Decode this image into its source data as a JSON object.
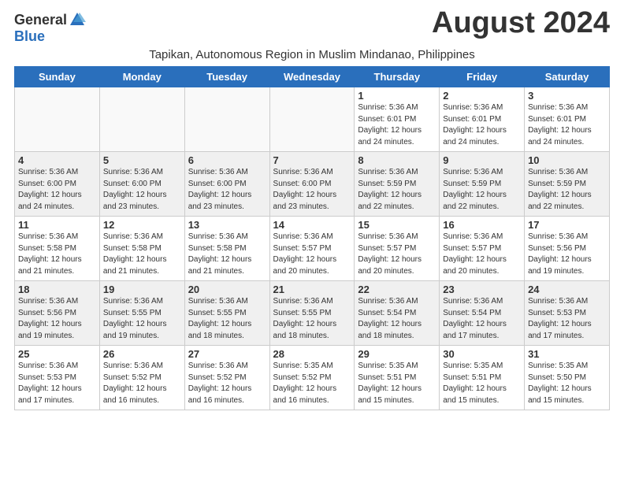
{
  "header": {
    "logo_general": "General",
    "logo_blue": "Blue",
    "month_title": "August 2024",
    "subtitle": "Tapikan, Autonomous Region in Muslim Mindanao, Philippines"
  },
  "days_of_week": [
    "Sunday",
    "Monday",
    "Tuesday",
    "Wednesday",
    "Thursday",
    "Friday",
    "Saturday"
  ],
  "weeks": [
    {
      "shade": "white",
      "cells": [
        {
          "day": "",
          "info": ""
        },
        {
          "day": "",
          "info": ""
        },
        {
          "day": "",
          "info": ""
        },
        {
          "day": "",
          "info": ""
        },
        {
          "day": "1",
          "info": "Sunrise: 5:36 AM\nSunset: 6:01 PM\nDaylight: 12 hours\nand 24 minutes."
        },
        {
          "day": "2",
          "info": "Sunrise: 5:36 AM\nSunset: 6:01 PM\nDaylight: 12 hours\nand 24 minutes."
        },
        {
          "day": "3",
          "info": "Sunrise: 5:36 AM\nSunset: 6:01 PM\nDaylight: 12 hours\nand 24 minutes."
        }
      ]
    },
    {
      "shade": "shaded",
      "cells": [
        {
          "day": "4",
          "info": "Sunrise: 5:36 AM\nSunset: 6:00 PM\nDaylight: 12 hours\nand 24 minutes."
        },
        {
          "day": "5",
          "info": "Sunrise: 5:36 AM\nSunset: 6:00 PM\nDaylight: 12 hours\nand 23 minutes."
        },
        {
          "day": "6",
          "info": "Sunrise: 5:36 AM\nSunset: 6:00 PM\nDaylight: 12 hours\nand 23 minutes."
        },
        {
          "day": "7",
          "info": "Sunrise: 5:36 AM\nSunset: 6:00 PM\nDaylight: 12 hours\nand 23 minutes."
        },
        {
          "day": "8",
          "info": "Sunrise: 5:36 AM\nSunset: 5:59 PM\nDaylight: 12 hours\nand 22 minutes."
        },
        {
          "day": "9",
          "info": "Sunrise: 5:36 AM\nSunset: 5:59 PM\nDaylight: 12 hours\nand 22 minutes."
        },
        {
          "day": "10",
          "info": "Sunrise: 5:36 AM\nSunset: 5:59 PM\nDaylight: 12 hours\nand 22 minutes."
        }
      ]
    },
    {
      "shade": "white",
      "cells": [
        {
          "day": "11",
          "info": "Sunrise: 5:36 AM\nSunset: 5:58 PM\nDaylight: 12 hours\nand 21 minutes."
        },
        {
          "day": "12",
          "info": "Sunrise: 5:36 AM\nSunset: 5:58 PM\nDaylight: 12 hours\nand 21 minutes."
        },
        {
          "day": "13",
          "info": "Sunrise: 5:36 AM\nSunset: 5:58 PM\nDaylight: 12 hours\nand 21 minutes."
        },
        {
          "day": "14",
          "info": "Sunrise: 5:36 AM\nSunset: 5:57 PM\nDaylight: 12 hours\nand 20 minutes."
        },
        {
          "day": "15",
          "info": "Sunrise: 5:36 AM\nSunset: 5:57 PM\nDaylight: 12 hours\nand 20 minutes."
        },
        {
          "day": "16",
          "info": "Sunrise: 5:36 AM\nSunset: 5:57 PM\nDaylight: 12 hours\nand 20 minutes."
        },
        {
          "day": "17",
          "info": "Sunrise: 5:36 AM\nSunset: 5:56 PM\nDaylight: 12 hours\nand 19 minutes."
        }
      ]
    },
    {
      "shade": "shaded",
      "cells": [
        {
          "day": "18",
          "info": "Sunrise: 5:36 AM\nSunset: 5:56 PM\nDaylight: 12 hours\nand 19 minutes."
        },
        {
          "day": "19",
          "info": "Sunrise: 5:36 AM\nSunset: 5:55 PM\nDaylight: 12 hours\nand 19 minutes."
        },
        {
          "day": "20",
          "info": "Sunrise: 5:36 AM\nSunset: 5:55 PM\nDaylight: 12 hours\nand 18 minutes."
        },
        {
          "day": "21",
          "info": "Sunrise: 5:36 AM\nSunset: 5:55 PM\nDaylight: 12 hours\nand 18 minutes."
        },
        {
          "day": "22",
          "info": "Sunrise: 5:36 AM\nSunset: 5:54 PM\nDaylight: 12 hours\nand 18 minutes."
        },
        {
          "day": "23",
          "info": "Sunrise: 5:36 AM\nSunset: 5:54 PM\nDaylight: 12 hours\nand 17 minutes."
        },
        {
          "day": "24",
          "info": "Sunrise: 5:36 AM\nSunset: 5:53 PM\nDaylight: 12 hours\nand 17 minutes."
        }
      ]
    },
    {
      "shade": "white",
      "cells": [
        {
          "day": "25",
          "info": "Sunrise: 5:36 AM\nSunset: 5:53 PM\nDaylight: 12 hours\nand 17 minutes."
        },
        {
          "day": "26",
          "info": "Sunrise: 5:36 AM\nSunset: 5:52 PM\nDaylight: 12 hours\nand 16 minutes."
        },
        {
          "day": "27",
          "info": "Sunrise: 5:36 AM\nSunset: 5:52 PM\nDaylight: 12 hours\nand 16 minutes."
        },
        {
          "day": "28",
          "info": "Sunrise: 5:35 AM\nSunset: 5:52 PM\nDaylight: 12 hours\nand 16 minutes."
        },
        {
          "day": "29",
          "info": "Sunrise: 5:35 AM\nSunset: 5:51 PM\nDaylight: 12 hours\nand 15 minutes."
        },
        {
          "day": "30",
          "info": "Sunrise: 5:35 AM\nSunset: 5:51 PM\nDaylight: 12 hours\nand 15 minutes."
        },
        {
          "day": "31",
          "info": "Sunrise: 5:35 AM\nSunset: 5:50 PM\nDaylight: 12 hours\nand 15 minutes."
        }
      ]
    }
  ]
}
